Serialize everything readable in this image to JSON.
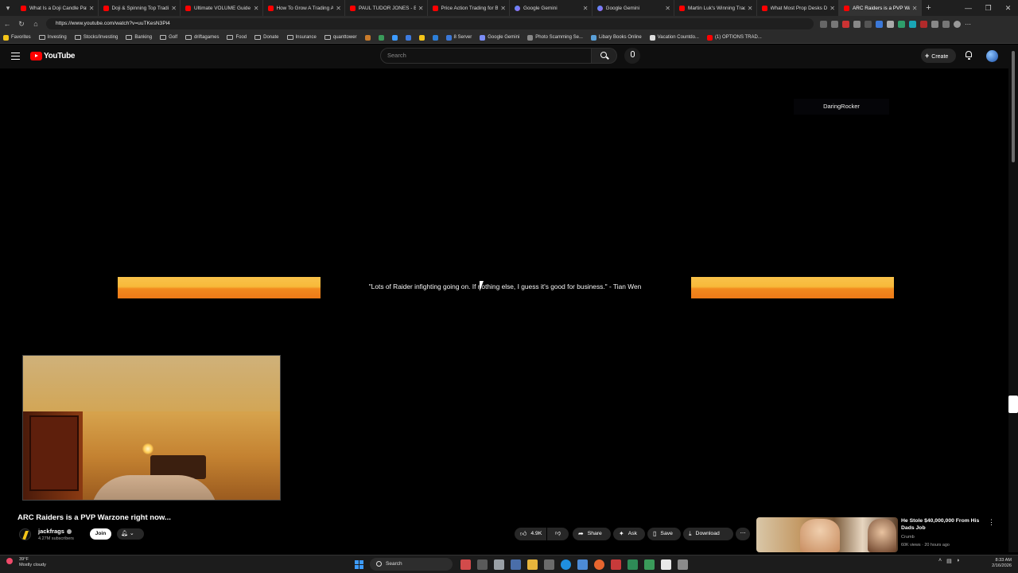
{
  "browser": {
    "tabs": [
      {
        "title": "What Is a Doji Candle Patte",
        "icon": "youtube-icon"
      },
      {
        "title": "Doji & Spinning Top Trading",
        "icon": "youtube-icon"
      },
      {
        "title": "Ultimate VOLUME Guide (He",
        "icon": "youtube-icon"
      },
      {
        "title": "How To Grow A Trading Acco",
        "icon": "youtube-icon"
      },
      {
        "title": "PAUL TUDOR JONES - Billion",
        "icon": "youtube-icon"
      },
      {
        "title": "Price Action Trading for Beg",
        "icon": "youtube-icon"
      },
      {
        "title": "Google Gemini",
        "icon": "gemini-icon"
      },
      {
        "title": "Google Gemini",
        "icon": "gemini-icon"
      },
      {
        "title": "Martin Luk's Winning Tradin",
        "icon": "youtube-icon"
      },
      {
        "title": "What Most Prop Desks Don",
        "icon": "youtube-icon"
      },
      {
        "title": "ARC Raiders is a PVP Warzo",
        "icon": "youtube-icon",
        "active": true
      }
    ],
    "url": "https://www.youtube.com/watch?v=uuTKesN3Pi4",
    "bookmarks": [
      {
        "label": "Favorites",
        "icon": "star-icon"
      },
      {
        "label": "Investing",
        "icon": "folder-icon"
      },
      {
        "label": "Stocks/Investing",
        "icon": "folder-icon"
      },
      {
        "label": "Banking",
        "icon": "folder-icon"
      },
      {
        "label": "Golf",
        "icon": "folder-icon"
      },
      {
        "label": "driftagames",
        "icon": "folder-icon"
      },
      {
        "label": "Food",
        "icon": "folder-icon"
      },
      {
        "label": "Donate",
        "icon": "folder-icon"
      },
      {
        "label": "Insurance",
        "icon": "folder-icon"
      },
      {
        "label": "quanttower",
        "icon": "folder-icon"
      },
      {
        "label": "8 Server",
        "icon": "server-icon"
      },
      {
        "label": "Google Gemini",
        "icon": "gemini-icon"
      },
      {
        "label": "Photo Scamming Se...",
        "icon": "photo-icon"
      },
      {
        "label": "Libary Books Online",
        "icon": "library-icon"
      },
      {
        "label": "Vacation Countdo...",
        "icon": "clock-icon"
      },
      {
        "label": "(1) OPTIONS TRAD...",
        "icon": "youtube-icon"
      }
    ]
  },
  "youtube": {
    "logo_text": "YouTube",
    "search_placeholder": "Search",
    "create_label": "Create",
    "video": {
      "overlay_channel_tag": "DaringRocker",
      "quote": "\"Lots of Raider infighting going on. If nothing else, I guess it's good for business.\" - Tian Wen",
      "bar_color_top": "#f9c24a",
      "bar_color_bottom": "#ee7a18"
    },
    "title": "ARC Raiders is a PVP Warzone right now...",
    "channel": {
      "name": "jackfrags",
      "subscribers": "4.27M subscribers",
      "join_label": "Join"
    },
    "actions": {
      "likes": "4.9K",
      "share": "Share",
      "ask": "Ask",
      "save": "Save",
      "download": "Download"
    },
    "recommended": {
      "title": "He Stole $40,000,000 From His Dads Job",
      "channel": "Crumb",
      "meta": "60K views · 20 hours ago"
    }
  },
  "taskbar": {
    "temperature": "39°F",
    "weather": "Mostly cloudy",
    "search_label": "Search",
    "time": "8:33 AM",
    "date": "2/16/2026"
  },
  "colors": {
    "yt_red": "#ff0000",
    "accent_blue": "#3d9bff"
  }
}
